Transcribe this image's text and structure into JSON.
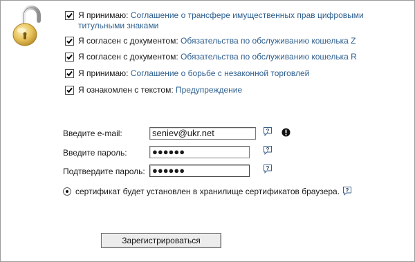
{
  "icons": {
    "lock": "padlock-icon",
    "help": "question-help-icon",
    "warning": "exclamation-icon"
  },
  "colors": {
    "link": "#2e5f8f",
    "text": "#1a1a1a"
  },
  "agreements": [
    {
      "prefix": "Я принимаю: ",
      "link": "Соглашение о трансфере имущественных прав цифровыми титульными знаками",
      "checked": true
    },
    {
      "prefix": "Я согласен с документом: ",
      "link": "Обязательства по обслуживанию кошелька Z",
      "checked": true
    },
    {
      "prefix": "Я согласен с документом: ",
      "link": "Обязательства по обслуживанию кошелька R",
      "checked": true
    },
    {
      "prefix": "Я принимаю: ",
      "link": "Соглашение о борьбе с незаконной торговлей",
      "checked": true
    },
    {
      "prefix": "Я ознакомлен с текстом: ",
      "link": "Предупреждение",
      "checked": true
    }
  ],
  "form": {
    "email_label": "Введите e-mail:",
    "email_value": "seniev@ukr.net",
    "password_label": "Введите пароль:",
    "password_value": "●●●●●●",
    "confirm_label": "Подтвердите пароль:",
    "confirm_value": "●●●●●●"
  },
  "certificate_option": "сертификат будет установлен в хранилище сертификатов браузера.",
  "submit_label": "Зарегистрироваться"
}
